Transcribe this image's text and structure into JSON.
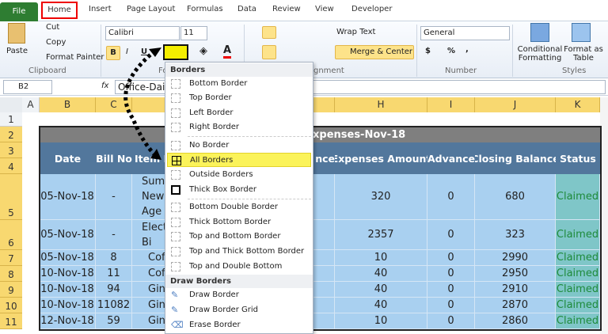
{
  "tabs": [
    "File",
    "Home",
    "Insert",
    "Page Layout",
    "Formulas",
    "Data",
    "Review",
    "View",
    "Developer"
  ],
  "ribbon": {
    "paste": "Paste",
    "cut": "Cut",
    "copy": "Copy",
    "format_painter": "Format Painter",
    "clipboard": "Clipboard",
    "font_name": "Calibri",
    "font_size": "11",
    "bold": "B",
    "italic": "I",
    "underline": "U",
    "font_group": "Fo",
    "wrap_text": "Wrap Text",
    "merge_center": "Merge & Center",
    "alignment": "gnment",
    "number_format": "General",
    "currency": "$",
    "percent": "%",
    "comma": ",",
    "number": "Number",
    "conditional_formatting": "Conditional Formatting",
    "format_as_table": "Format as Table",
    "styles": "Styles"
  },
  "formula_bar": {
    "name_box": "B2",
    "fx": "fx",
    "value": "Office-Dail"
  },
  "columns": [
    "A",
    "B",
    "C",
    "D",
    "H",
    "I",
    "J",
    "K"
  ],
  "rows": [
    "1",
    "2",
    "3",
    "4",
    "5",
    "6",
    "7",
    "8",
    "9",
    "10",
    "11"
  ],
  "sheet": {
    "title": "xpenses-Nov-18",
    "headers": {
      "date": "Date",
      "bill": "Bill No",
      "item": "Item N",
      "bal": "nce",
      "exp": "Expenses Amount",
      "adv": "Advance",
      "close": "Closing Balance",
      "status": "Status"
    },
    "data": [
      {
        "date": "05-Nov-18",
        "bill": "-",
        "item": [
          "Sumu",
          "News",
          "Age"
        ],
        "exp": "320",
        "adv": "0",
        "close": "680",
        "status": "Claimed"
      },
      {
        "date": "05-Nov-18",
        "bill": "-",
        "item": [
          "Elect",
          "Bi"
        ],
        "exp": "2357",
        "adv": "0",
        "close": "323",
        "status": "Claimed"
      },
      {
        "date": "05-Nov-18",
        "bill": "8",
        "item": [
          "Cof"
        ],
        "exp": "10",
        "adv": "0",
        "close": "2990",
        "status": "Claimed"
      },
      {
        "date": "10-Nov-18",
        "bill": "11",
        "item": [
          "Cof"
        ],
        "exp": "40",
        "adv": "0",
        "close": "2950",
        "status": "Claimed"
      },
      {
        "date": "10-Nov-18",
        "bill": "94",
        "item": [
          "Ginge"
        ],
        "exp": "40",
        "adv": "0",
        "close": "2910",
        "status": "Claimed"
      },
      {
        "date": "10-Nov-18",
        "bill": "11082",
        "item": [
          "Ginge"
        ],
        "exp": "40",
        "adv": "0",
        "close": "2870",
        "status": "Claimed"
      },
      {
        "date": "12-Nov-18",
        "bill": "59",
        "item": [
          "Ginge"
        ],
        "exp": "10",
        "adv": "0",
        "close": "2860",
        "status": "Claimed"
      }
    ]
  },
  "menu": {
    "header": "Borders",
    "items": [
      "Bottom Border",
      "Top Border",
      "Left Border",
      "Right Border",
      "No Border",
      "All Borders",
      "Outside Borders",
      "Thick Box Border",
      "Bottom Double Border",
      "Thick Bottom Border",
      "Top and Bottom Border",
      "Top and Thick Bottom Border",
      "Top and Double Bottom Border"
    ],
    "draw_header": "Draw Borders",
    "draw_items": [
      "Draw Border",
      "Draw Border Grid",
      "Erase Border"
    ],
    "selected": "All Borders"
  },
  "colors": {
    "header_blue": "#52779c",
    "cell_blue": "#a9d0f0",
    "status_teal": "#7fc6c8",
    "highlight": "#fbf35a",
    "title_gray": "#7f7f7f"
  }
}
